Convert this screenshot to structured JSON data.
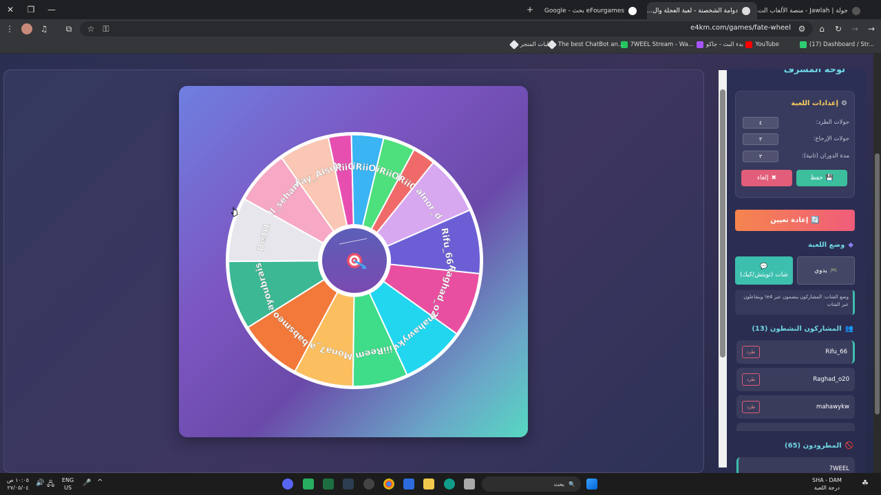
{
  "browser": {
    "tabs": [
      {
        "title": "جولة | Jawlah - منصة الألعاب الت...",
        "active": false
      },
      {
        "title": "دوامة الشخصنة - لعبة العجلة وال...",
        "active": true
      },
      {
        "title": "eFourgames بحث - Google",
        "active": false
      }
    ],
    "new_tab": "+",
    "url": "e4km.com/games/fate-wheel",
    "bookmarks": [
      {
        "label": "(17) Dashboard / Str...",
        "color": "#2ecc71"
      },
      {
        "label": "YouTube",
        "color": "#ff0000"
      },
      {
        "label": "بدء البث - جاكو",
        "color": "#a855f7"
      },
      {
        "label": "7WEEL Stream - Wa...",
        "color": "#22c55e"
      },
      {
        "label": "The best ChatBot an...",
        "color": "#e5e7eb"
      },
      {
        "label": "طلبات المتجر",
        "color": "#e5e7eb"
      }
    ]
  },
  "wheel": {
    "segments": [
      {
        "label": "iRiiO",
        "color": "#e64fb0"
      },
      {
        "label": "iRiiO",
        "color": "#3ab4f2"
      },
      {
        "label": "iRiiO",
        "color": "#4ee07c"
      },
      {
        "label": "iRiiO",
        "color": "#f06a6a"
      },
      {
        "label": "alnor_d",
        "color": "#d7a8f0"
      },
      {
        "label": "Rifu_66",
        "color": "#6c5fd6"
      },
      {
        "label": "Raghad_o20",
        "color": "#e94fa0"
      },
      {
        "label": "mahawykw",
        "color": "#22d6f0"
      },
      {
        "label": "iiiReem",
        "color": "#3fdc8a"
      },
      {
        "label": "Mona7_a",
        "color": "#fbbf60"
      },
      {
        "label": "babsmeo",
        "color": "#f2793a"
      },
      {
        "label": "ayoubrais",
        "color": "#3db894"
      },
      {
        "label": "De3l1",
        "color": "#e6e6ec"
      },
      {
        "label": "ll_seham",
        "color": "#f6a8c4"
      },
      {
        "label": ".Fay_Alsub",
        "color": "#f9c7b3"
      }
    ]
  },
  "panel": {
    "title": "لوحة المشرف",
    "settings": {
      "heading": "إعدادات اللعبة",
      "fields": [
        {
          "label": "جولات الطرد:",
          "value": "٤"
        },
        {
          "label": "جولات الإرجاع:",
          "value": "٣"
        },
        {
          "label": "مدة الدوران (ثانية):",
          "value": "٣"
        }
      ],
      "save": "حفظ",
      "cancel": "إلغاء"
    },
    "reset": "إعادة تعيين",
    "mode": {
      "heading": "وضع اللعبة",
      "manual": "يدوي",
      "chat": "شات (تويتش/كيك)",
      "note": "وضع الشات: المشاركون ينضمون عبر e4! ويتفاعلون عبر الشات"
    },
    "active": {
      "heading": "المشاركون النشطون (13)",
      "players": [
        "Rifu_66",
        "Raghad_o20",
        "mahawykw"
      ],
      "kick": "طرد"
    },
    "kicked": {
      "heading": "المطرودون (65)",
      "first": "7WEEL"
    }
  },
  "taskbar": {
    "search": "بحث",
    "lang": "ENG",
    "region": "US",
    "time": "١٠:٠٥ ص",
    "date": "٢٧/٠٥/٠٤",
    "weather": "SHA - DAM",
    "weather_sub": "درجة اللعبة"
  }
}
